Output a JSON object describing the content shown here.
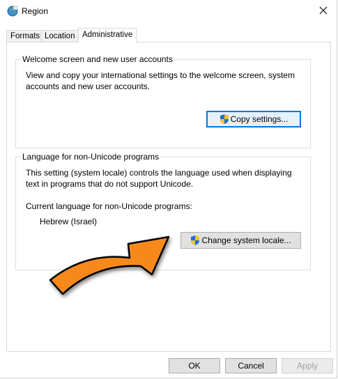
{
  "window": {
    "title": "Region",
    "icon": "globe-region-icon",
    "close_icon": "close-icon"
  },
  "tabs": [
    {
      "label": "Formats",
      "active": false
    },
    {
      "label": "Location",
      "active": false
    },
    {
      "label": "Administrative",
      "active": true
    }
  ],
  "welcome_group": {
    "title": "Welcome screen and new user accounts",
    "description": "View and copy your international settings to the welcome screen, system accounts and new user accounts.",
    "button_label": "Copy settings..."
  },
  "non_unicode_group": {
    "title": "Language for non-Unicode programs",
    "description": "This setting (system locale) controls the language used when displaying text in programs that do not support Unicode.",
    "current_label": "Current language for non-Unicode programs:",
    "current_value": "Hebrew (Israel)",
    "button_label": "Change system locale..."
  },
  "footer": {
    "ok_label": "OK",
    "cancel_label": "Cancel",
    "apply_label": "Apply",
    "apply_enabled": false
  },
  "annotation": {
    "arrow_color": "#f7891f",
    "arrow_outline": "#000000",
    "icon": "orange-pointer-arrow"
  },
  "colors": {
    "focus_border": "#0078d7",
    "button_face": "#e1e1e1",
    "shield_blue": "#1e6fd0",
    "shield_yellow": "#f2c12e"
  }
}
